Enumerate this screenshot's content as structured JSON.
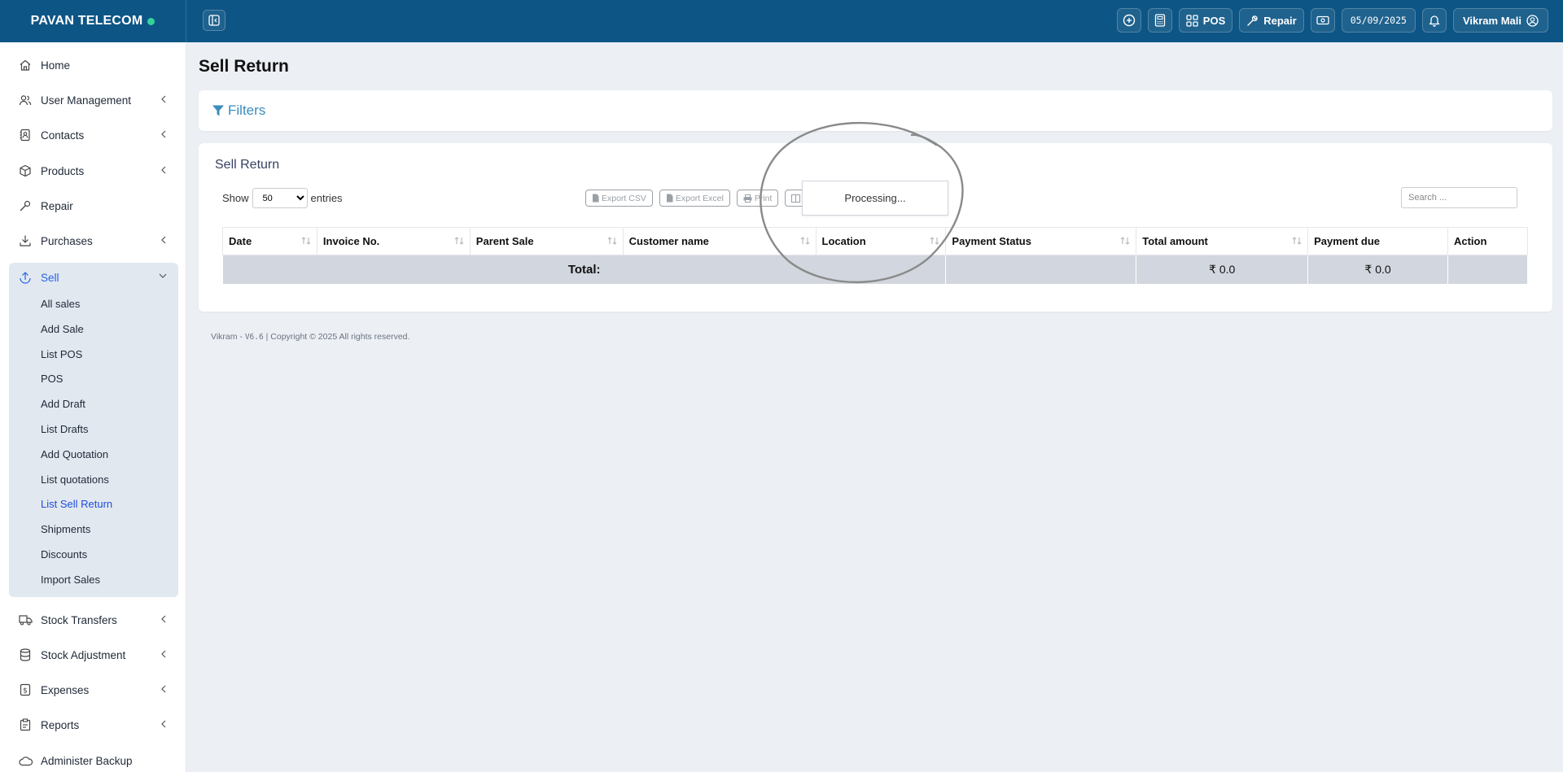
{
  "brand": {
    "name": "PAVAN TELECOM"
  },
  "topbar": {
    "pos_label": "POS",
    "repair_label": "Repair",
    "date": "05/09/2025",
    "user_name": "Vikram Mali"
  },
  "sidebar": {
    "items": [
      {
        "label": "Home",
        "icon": "home-icon"
      },
      {
        "label": "User Management",
        "icon": "users-icon"
      },
      {
        "label": "Contacts",
        "icon": "address-book-icon"
      },
      {
        "label": "Products",
        "icon": "box-icon"
      },
      {
        "label": "Repair",
        "icon": "wrench-icon"
      },
      {
        "label": "Purchases",
        "icon": "download-icon"
      },
      {
        "label": "Sell",
        "icon": "upload-icon"
      },
      {
        "label": "Stock Transfers",
        "icon": "truck-icon"
      },
      {
        "label": "Stock Adjustment",
        "icon": "database-icon"
      },
      {
        "label": "Expenses",
        "icon": "dollar-icon"
      },
      {
        "label": "Reports",
        "icon": "report-icon"
      },
      {
        "label": "Administer Backup",
        "icon": "cloud-icon"
      }
    ],
    "sell_sub": [
      "All sales",
      "Add Sale",
      "List POS",
      "POS",
      "Add Draft",
      "List Drafts",
      "Add Quotation",
      "List quotations",
      "List Sell Return",
      "Shipments",
      "Discounts",
      "Import Sales"
    ]
  },
  "main": {
    "page_title": "Sell Return",
    "filters_label": "Filters",
    "card_title": "Sell Return",
    "show_label": "Show",
    "entries_label": "entries",
    "page_length": "50",
    "export_buttons": [
      "Export CSV",
      "Export Excel",
      "Print"
    ],
    "processing_text": "Processing...",
    "search_placeholder": "Search ...",
    "table": {
      "columns": [
        "Date",
        "Invoice No.",
        "Parent Sale",
        "Customer name",
        "Location",
        "Payment Status",
        "Total amount",
        "Payment due",
        "Action"
      ],
      "total_label": "Total:",
      "total_amount": "₹ 0.0",
      "payment_due": "₹ 0.0"
    }
  },
  "footer": {
    "author": "Vikram -",
    "version": "V6.6",
    "copyright": "| Copyright © 2025 All rights reserved."
  },
  "colors": {
    "topbar": "#0d5585",
    "accent": "#3c8dbc",
    "active": "#1d4ed8",
    "status_dot": "#34d399"
  }
}
